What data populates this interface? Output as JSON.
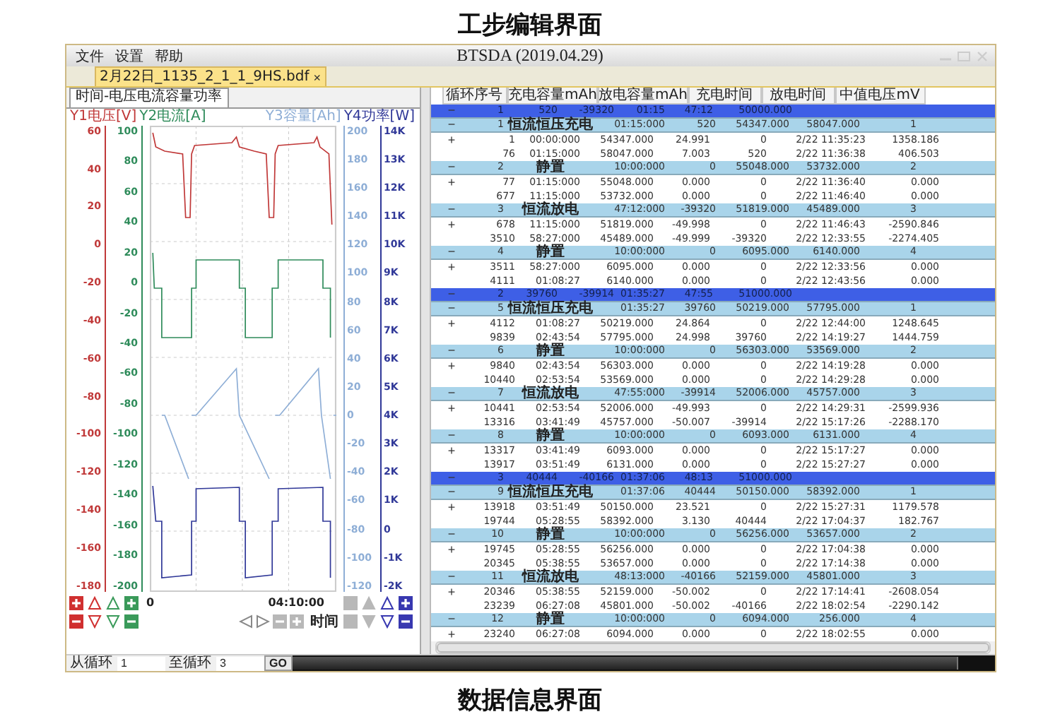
{
  "heading_top": "工步编辑界面",
  "window": {
    "title": "BTSDA (2019.04.29)",
    "menu": [
      "文件",
      "设置",
      "帮助"
    ]
  },
  "file_tab": {
    "label": "2月22日_1135_2_1_1_9HS.bdf",
    "close": "×"
  },
  "chart": {
    "tab": "时间-电压电流容量功率",
    "axes": [
      {
        "label": "Y1电压[V]",
        "color": "#c03838",
        "ticks": [
          "60",
          "40",
          "20",
          "0",
          "-20",
          "-40",
          "-60",
          "-80",
          "-100",
          "-120",
          "-140",
          "-160",
          "-180"
        ]
      },
      {
        "label": "Y2电流[A]",
        "color": "#2e8b5a",
        "ticks": [
          "100",
          "80",
          "60",
          "40",
          "20",
          "0",
          "-20",
          "-40",
          "-60",
          "-80",
          "-100",
          "-120",
          "-140",
          "-160",
          "-180",
          "-200"
        ]
      },
      {
        "label": "Y3容量[Ah]",
        "color": "#8eaed6",
        "ticks": [
          "200",
          "180",
          "160",
          "140",
          "120",
          "100",
          "80",
          "60",
          "40",
          "20",
          "0",
          "-20",
          "-40",
          "-60",
          "-80",
          "-100",
          "-120"
        ]
      },
      {
        "label": "Y4功率[W]",
        "color": "#303898",
        "ticks": [
          "14K",
          "13K",
          "12K",
          "11K",
          "10K",
          "9K",
          "8K",
          "7K",
          "6K",
          "5K",
          "4K",
          "3K",
          "2K",
          "1K",
          "0",
          "-1K",
          "-2K"
        ]
      }
    ],
    "x_ticks": [
      "0",
      "04:10:00"
    ],
    "x_button": "时间"
  },
  "table": {
    "columns": [
      "循环序号",
      "充电容量mAh",
      "放电容量mAh",
      "充电时间",
      "放电时间",
      "中值电压mV"
    ],
    "cycles": [
      {
        "toggle": "−",
        "cells": [
          "1",
          "520",
          "-39320",
          "01:15",
          "47:12",
          "50000.000"
        ],
        "children": [
          {
            "toggle": "−",
            "cells": [
              "1",
              "恒流恒压充电",
              "01:15:000",
              "520",
              "54347.000",
              "58047.000",
              "1"
            ],
            "children": [
              {
                "toggle": "+",
                "cells": [
                  "1",
                  "00:00:000",
                  "54347.000",
                  "24.991",
                  "0",
                  "2/22 11:35:23",
                  "1358.186"
                ]
              },
              {
                "cells": [
                  "76",
                  "01:15:000",
                  "58047.000",
                  "7.003",
                  "520",
                  "2/22 11:36:38",
                  "406.503"
                ]
              }
            ]
          },
          {
            "toggle": "−",
            "cells": [
              "2",
              "静置",
              "10:00:000",
              "0",
              "55048.000",
              "53732.000",
              "2"
            ],
            "children": [
              {
                "toggle": "+",
                "cells": [
                  "77",
                  "01:15:000",
                  "55048.000",
                  "0.000",
                  "0",
                  "2/22 11:36:40",
                  "0.000"
                ]
              },
              {
                "cells": [
                  "677",
                  "11:15:000",
                  "53732.000",
                  "0.000",
                  "0",
                  "2/22 11:46:40",
                  "0.000"
                ]
              }
            ]
          },
          {
            "toggle": "−",
            "cells": [
              "3",
              "恒流放电",
              "47:12:000",
              "-39320",
              "51819.000",
              "45489.000",
              "3"
            ],
            "children": [
              {
                "toggle": "+",
                "cells": [
                  "678",
                  "11:15:000",
                  "51819.000",
                  "-49.998",
                  "0",
                  "2/22 11:46:43",
                  "-2590.846"
                ]
              },
              {
                "cells": [
                  "3510",
                  "58:27:000",
                  "45489.000",
                  "-49.999",
                  "-39320",
                  "2/22 12:33:55",
                  "-2274.405"
                ]
              }
            ]
          },
          {
            "toggle": "−",
            "cells": [
              "4",
              "静置",
              "10:00:000",
              "0",
              "6095.000",
              "6140.000",
              "4"
            ],
            "children": [
              {
                "toggle": "+",
                "cells": [
                  "3511",
                  "58:27:000",
                  "6095.000",
                  "0.000",
                  "0",
                  "2/22 12:33:56",
                  "0.000"
                ]
              },
              {
                "cells": [
                  "4111",
                  "01:08:27",
                  "6140.000",
                  "0.000",
                  "0",
                  "2/22 12:43:56",
                  "0.000"
                ]
              }
            ]
          }
        ]
      },
      {
        "toggle": "−",
        "cells": [
          "2",
          "39760",
          "-39914",
          "01:35:27",
          "47:55",
          "51000.000"
        ],
        "children": [
          {
            "toggle": "−",
            "cells": [
              "5",
              "恒流恒压充电",
              "01:35:27",
              "39760",
              "50219.000",
              "57795.000",
              "1"
            ],
            "children": [
              {
                "toggle": "+",
                "cells": [
                  "4112",
                  "01:08:27",
                  "50219.000",
                  "24.864",
                  "0",
                  "2/22 12:44:00",
                  "1248.645"
                ]
              },
              {
                "cells": [
                  "9839",
                  "02:43:54",
                  "57795.000",
                  "24.998",
                  "39760",
                  "2/22 14:19:27",
                  "1444.759"
                ]
              }
            ]
          },
          {
            "toggle": "−",
            "cells": [
              "6",
              "静置",
              "10:00:000",
              "0",
              "56303.000",
              "53569.000",
              "2"
            ],
            "children": [
              {
                "toggle": "+",
                "cells": [
                  "9840",
                  "02:43:54",
                  "56303.000",
                  "0.000",
                  "0",
                  "2/22 14:19:28",
                  "0.000"
                ]
              },
              {
                "cells": [
                  "10440",
                  "02:53:54",
                  "53569.000",
                  "0.000",
                  "0",
                  "2/22 14:29:28",
                  "0.000"
                ]
              }
            ]
          },
          {
            "toggle": "−",
            "cells": [
              "7",
              "恒流放电",
              "47:55:000",
              "-39914",
              "52006.000",
              "45757.000",
              "3"
            ],
            "children": [
              {
                "toggle": "+",
                "cells": [
                  "10441",
                  "02:53:54",
                  "52006.000",
                  "-49.993",
                  "0",
                  "2/22 14:29:31",
                  "-2599.936"
                ]
              },
              {
                "cells": [
                  "13316",
                  "03:41:49",
                  "45757.000",
                  "-50.007",
                  "-39914",
                  "2/22 15:17:26",
                  "-2288.170"
                ]
              }
            ]
          },
          {
            "toggle": "−",
            "cells": [
              "8",
              "静置",
              "10:00:000",
              "0",
              "6093.000",
              "6131.000",
              "4"
            ],
            "children": [
              {
                "toggle": "+",
                "cells": [
                  "13317",
                  "03:41:49",
                  "6093.000",
                  "0.000",
                  "0",
                  "2/22 15:17:27",
                  "0.000"
                ]
              },
              {
                "cells": [
                  "13917",
                  "03:51:49",
                  "6131.000",
                  "0.000",
                  "0",
                  "2/22 15:27:27",
                  "0.000"
                ]
              }
            ]
          }
        ]
      },
      {
        "toggle": "−",
        "cells": [
          "3",
          "40444",
          "-40166",
          "01:37:06",
          "48:13",
          "51000.000"
        ],
        "children": [
          {
            "toggle": "−",
            "cells": [
              "9",
              "恒流恒压充电",
              "01:37:06",
              "40444",
              "50150.000",
              "58392.000",
              "1"
            ],
            "children": [
              {
                "toggle": "+",
                "cells": [
                  "13918",
                  "03:51:49",
                  "50150.000",
                  "23.521",
                  "0",
                  "2/22 15:27:31",
                  "1179.578"
                ]
              },
              {
                "cells": [
                  "19744",
                  "05:28:55",
                  "58392.000",
                  "3.130",
                  "40444",
                  "2/22 17:04:37",
                  "182.767"
                ]
              }
            ]
          },
          {
            "toggle": "−",
            "cells": [
              "10",
              "静置",
              "10:00:000",
              "0",
              "56256.000",
              "53657.000",
              "2"
            ],
            "children": [
              {
                "toggle": "+",
                "cells": [
                  "19745",
                  "05:28:55",
                  "56256.000",
                  "0.000",
                  "0",
                  "2/22 17:04:38",
                  "0.000"
                ]
              },
              {
                "cells": [
                  "20345",
                  "05:38:55",
                  "53657.000",
                  "0.000",
                  "0",
                  "2/22 17:14:38",
                  "0.000"
                ]
              }
            ]
          },
          {
            "toggle": "−",
            "cells": [
              "11",
              "恒流放电",
              "48:13:000",
              "-40166",
              "52159.000",
              "45801.000",
              "3"
            ],
            "children": [
              {
                "toggle": "+",
                "cells": [
                  "20346",
                  "05:38:55",
                  "52159.000",
                  "-50.002",
                  "0",
                  "2/22 17:14:41",
                  "-2608.054"
                ]
              },
              {
                "cells": [
                  "23239",
                  "06:27:08",
                  "45801.000",
                  "-50.002",
                  "-40166",
                  "2/22 18:02:54",
                  "-2290.142"
                ]
              }
            ]
          },
          {
            "toggle": "−",
            "cells": [
              "12",
              "静置",
              "10:00:000",
              "0",
              "6094.000",
              "256.000",
              "4"
            ],
            "children": [
              {
                "toggle": "+",
                "cells": [
                  "23240",
                  "06:27:08",
                  "6094.000",
                  "0.000",
                  "0",
                  "2/22 18:02:55",
                  "0.000"
                ]
              }
            ]
          }
        ]
      }
    ]
  },
  "status_bar": {
    "from_label": "从循环",
    "from_value": "1",
    "to_label": "至循环",
    "to_value": "3",
    "go": "GO"
  },
  "heading_bottom": "数据信息界面"
}
